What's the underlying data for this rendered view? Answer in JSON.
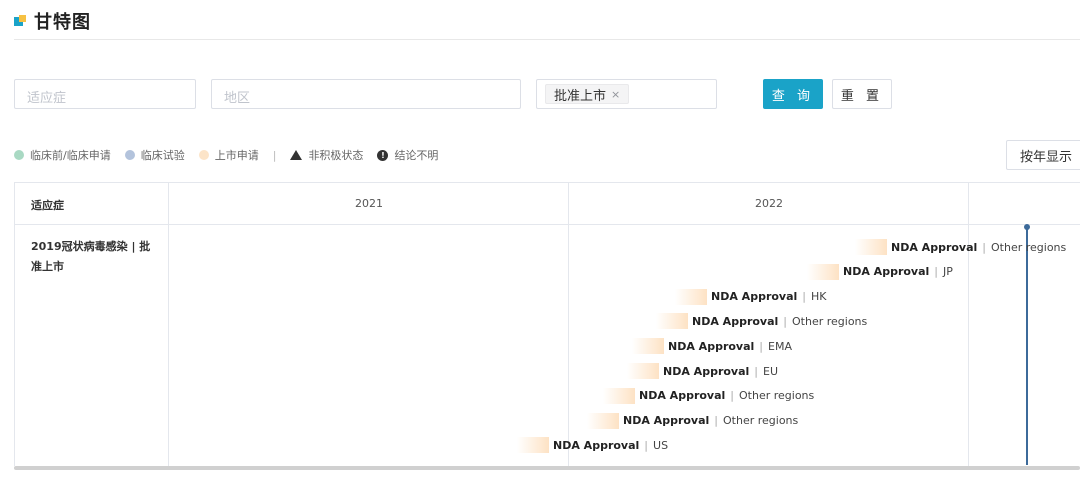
{
  "header": {
    "title": "甘特图"
  },
  "filters": {
    "indication_placeholder": "适应症",
    "region_placeholder": "地区",
    "status_tag": "批准上市",
    "status_tag_remove": "×"
  },
  "buttons": {
    "query": "查 询",
    "reset": "重 置",
    "view_mode": "按年显示"
  },
  "legend": {
    "items": [
      "临床前/临床申请",
      "临床试验",
      "上市申请"
    ],
    "separator": "|",
    "inactive": "非积极状态",
    "unclear": "结论不明"
  },
  "gantt": {
    "column_header": "适应症",
    "years": [
      "2021",
      "2022"
    ],
    "row_label": "2019冠状病毒感染 | 批准上市",
    "bars": [
      {
        "phase": "NDA Approval",
        "region": "Other regions"
      },
      {
        "phase": "NDA Approval",
        "region": "JP"
      },
      {
        "phase": "NDA Approval",
        "region": "HK"
      },
      {
        "phase": "NDA Approval",
        "region": "Other regions"
      },
      {
        "phase": "NDA Approval",
        "region": "EMA"
      },
      {
        "phase": "NDA Approval",
        "region": "EU"
      },
      {
        "phase": "NDA Approval",
        "region": "Other regions"
      },
      {
        "phase": "NDA Approval",
        "region": "Other regions"
      },
      {
        "phase": "NDA Approval",
        "region": "US"
      }
    ],
    "pipe": "|"
  },
  "colors": {
    "accent": "#1aa3c8",
    "title_mark_yellow": "#f6c143",
    "legend_preclinical": "#a9d9c3",
    "legend_clinical": "#b3c3dc",
    "legend_filing": "#fce4c8",
    "today_line": "#3c6a9a"
  },
  "icons": {
    "title": "title-square-icon",
    "tag_close": "close-icon",
    "inactive": "triangle-icon",
    "unclear": "exclamation-icon"
  }
}
